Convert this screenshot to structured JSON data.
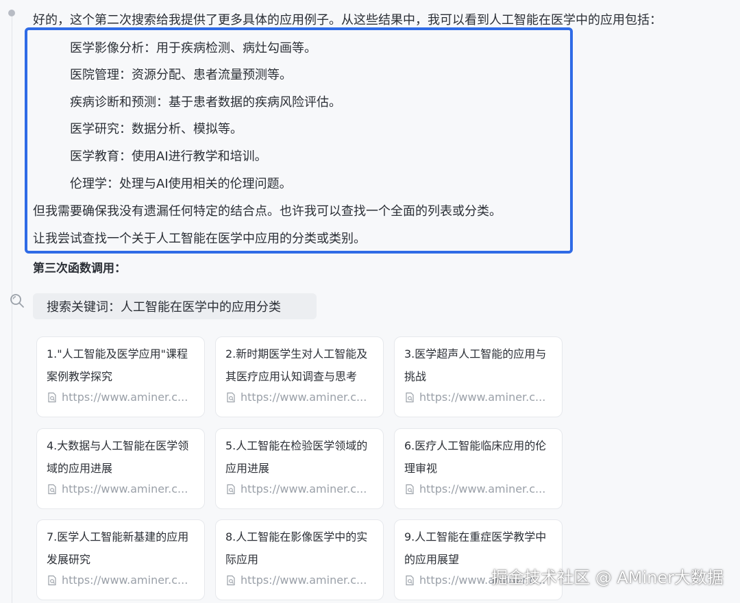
{
  "intro": "好的，这个第二次搜索给我提供了更多具体的应用例子。从这些结果中，我可以看到人工智能在医学中的应用包括：",
  "applications": [
    "医学影像分析：用于疾病检测、病灶勾画等。",
    "医院管理：资源分配、患者流量预测等。",
    "疾病诊断和预测：基于患者数据的疾病风险评估。",
    "医学研究：数据分析、模拟等。",
    "医学教育：使用AI进行教学和培训。",
    "伦理学：处理与AI使用相关的伦理问题。"
  ],
  "para1": "但我需要确保我没有遗漏任何特定的结合点。也许我可以查找一个全面的列表或分类。",
  "para2": "让我尝试查找一个关于人工智能在医学中应用的分类或类别。",
  "heading": "第三次函数调用：",
  "search_query": "搜索关键词：人工智能在医学中的应用分类",
  "results": [
    {
      "title": "1.\"人工智能及医学应用\"课程案例教学探究",
      "url": "https://www.aminer.c..."
    },
    {
      "title": "2.新时期医学生对人工智能及其医疗应用认知调查与思考",
      "url": "https://www.aminer.c..."
    },
    {
      "title": "3.医学超声人工智能的应用与挑战",
      "url": "https://www.aminer.c..."
    },
    {
      "title": "4.大数据与人工智能在医学领域的应用进展",
      "url": "https://www.aminer.c..."
    },
    {
      "title": "5.人工智能在检验医学领域的应用进展",
      "url": "https://www.aminer.c..."
    },
    {
      "title": "6.医疗人工智能临床应用的伦理审视",
      "url": "https://www.aminer.c..."
    },
    {
      "title": "7.医学人工智能新基建的应用发展研究",
      "url": "https://www.aminer.c..."
    },
    {
      "title": "8.人工智能在影像医学中的实际应用",
      "url": "https://www.aminer.c..."
    },
    {
      "title": "9.人工智能在重症医学教学中的应用展望",
      "url": "https://www.aminer.c..."
    }
  ],
  "watermark": "掘金技术社区 @ AMiner大数据",
  "colors": {
    "highlight": "#2f6be6",
    "text": "#2b2f36",
    "muted": "#9aa0a8",
    "background": "#f7f8fa"
  }
}
